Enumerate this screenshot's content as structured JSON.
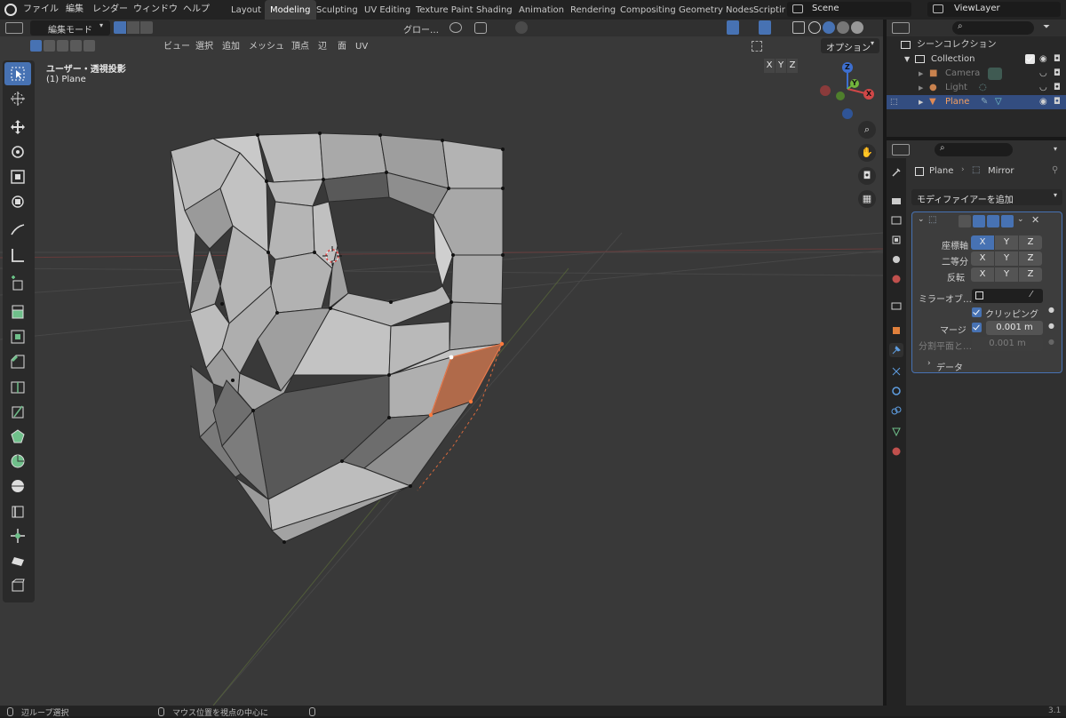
{
  "topbar": {
    "menus": [
      "ファイル",
      "編集",
      "レンダー",
      "ウィンドウ",
      "ヘルプ"
    ],
    "workspaces": [
      "Layout",
      "Modeling",
      "Sculpting",
      "UV Editing",
      "Texture Paint",
      "Shading",
      "Animation",
      "Rendering",
      "Compositing",
      "Geometry Nodes",
      "Scriptir"
    ],
    "active_workspace": "Modeling",
    "scene": "Scene",
    "view_layer": "ViewLayer"
  },
  "viewport_header": {
    "mode": "編集モード",
    "menus": [
      "ビュー",
      "選択",
      "追加",
      "メッシュ",
      "頂点",
      "辺",
      "面",
      "UV"
    ],
    "transform_orientation": "グロー…",
    "axes": [
      "X",
      "Y",
      "Z"
    ],
    "options": "オプション"
  },
  "viewport": {
    "view_name": "ユーザー・透視投影",
    "object_name": "(1) Plane",
    "gizmo_labels": [
      "Z",
      "Y",
      "X"
    ]
  },
  "outliner": {
    "title": "シーンコレクション",
    "items": [
      {
        "name": "Collection",
        "level": 1
      },
      {
        "name": "Camera",
        "level": 2
      },
      {
        "name": "Light",
        "level": 2
      },
      {
        "name": "Plane",
        "level": 2,
        "selected": true
      }
    ]
  },
  "properties": {
    "breadcrumb_object": "Plane",
    "breadcrumb_modifier": "Mirror",
    "add_modifier": "モディファイアーを追加",
    "rows": {
      "axis_label": "座標軸",
      "bisect_label": "二等分",
      "flip_label": "反転",
      "mirror_object_label": "ミラーオブ…",
      "clipping_label": "クリッピング",
      "merge_label": "マージ",
      "merge_value": "0.001 m",
      "bisect_distance_label": "分割平面と…",
      "bisect_distance_value": "0.001 m",
      "data_label": "データ"
    },
    "xyz": [
      "X",
      "Y",
      "Z"
    ]
  },
  "statusbar": {
    "left": "辺ループ選択",
    "middle": "マウス位置を視点の中心に",
    "version": "3.1"
  },
  "colors": {
    "accent": "#4772b3",
    "selected_face": "#b06a4a",
    "panel_bg": "#303030",
    "viewport_bg": "#393939"
  }
}
